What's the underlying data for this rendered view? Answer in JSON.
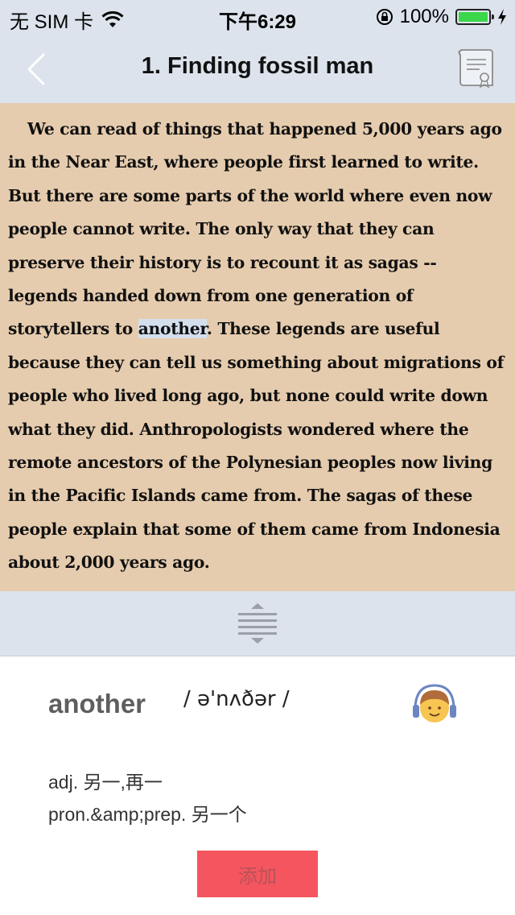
{
  "status_bar": {
    "carrier": "无 SIM 卡",
    "time": "下午6:29",
    "battery": "100%",
    "battery_level": 1.0,
    "icons": [
      "wifi-icon",
      "rotation-lock-icon",
      "battery-icon",
      "charging-icon"
    ]
  },
  "nav": {
    "title": "1. Finding fossil man",
    "back_icon": "chevron-left-icon",
    "right_icon": "certificate-icon"
  },
  "passage": {
    "before": "We can read of things that happened 5,000 years ago in the Near East, where people first learned to write.  But there are some parts of the world where even now people cannot write. The only way that they can preserve their history is to recount it as sagas -- legends handed down from one generation of storytellers to ",
    "highlight": "another",
    "after": ". These legends are useful because they can tell us something about migrations of people who lived long ago, but none could write down what they did. Anthropologists wondered where the remote ancestors of the Polynesian peoples now living in the Pacific Islands came from. The sagas of these people explain that some of them came from Indonesia about 2,000 years ago."
  },
  "lookup": {
    "word": "another",
    "phonetic": "/ ə'nʌðər /",
    "definitions": [
      "adj. 另一,再一",
      "pron.&amp;prep. 另一个"
    ],
    "add_label": "添加"
  },
  "colors": {
    "bar_bg": "#dce3ec",
    "reading_bg": "#e6ccae",
    "highlight_bg": "#d4dfee",
    "add_button_bg": "#f5555e",
    "add_button_text": "#b8525a"
  }
}
